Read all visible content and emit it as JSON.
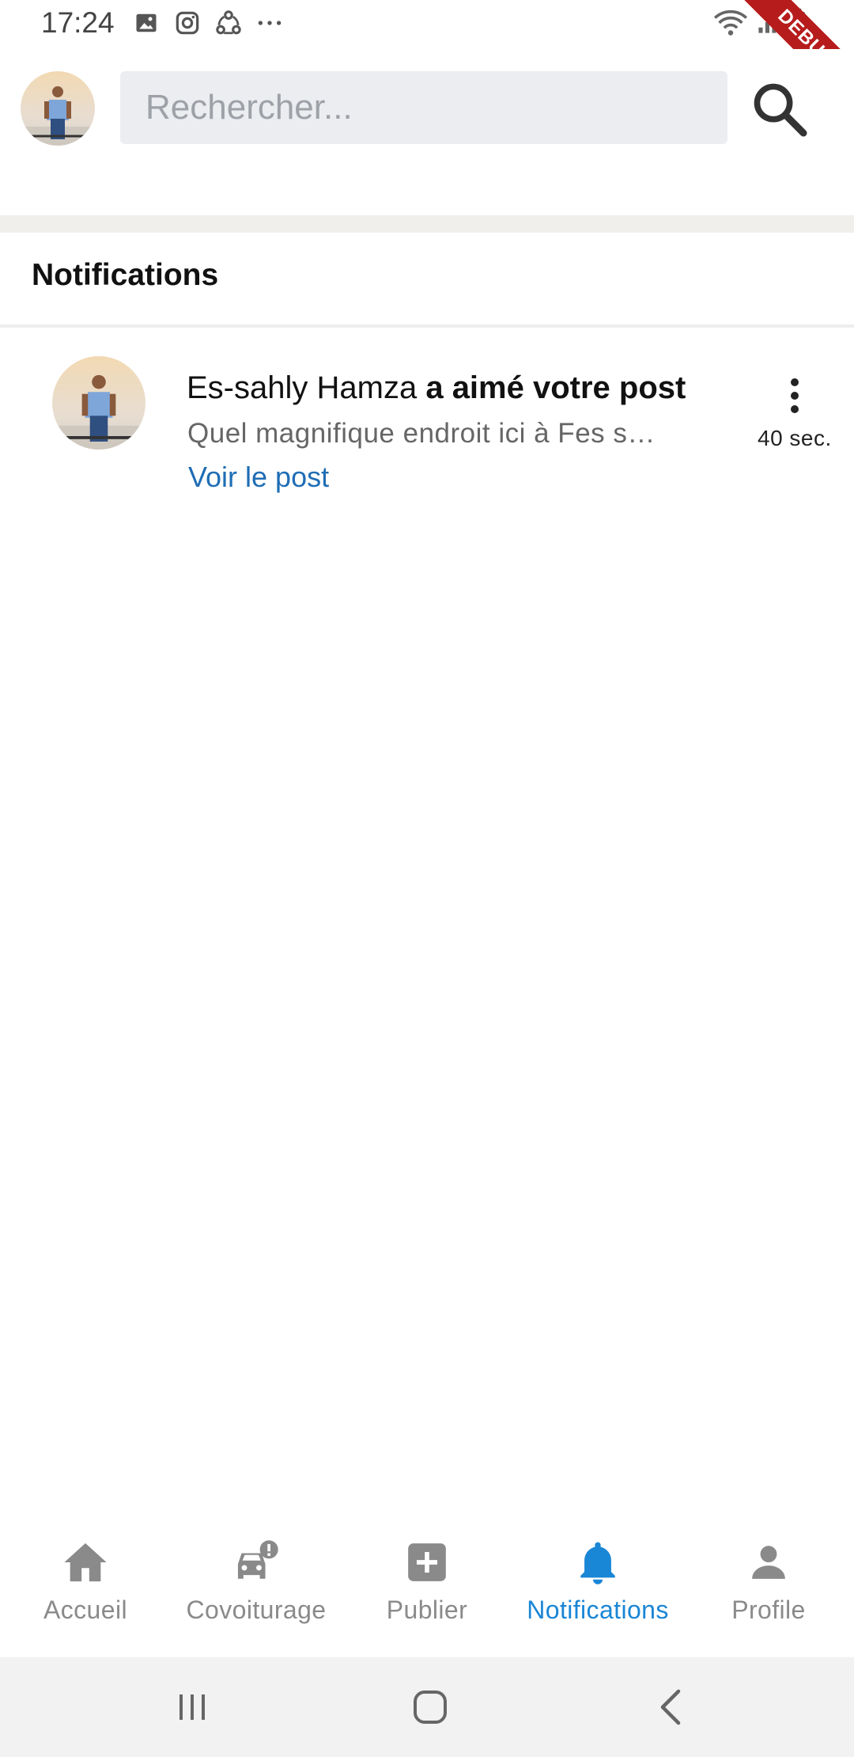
{
  "status_bar": {
    "time": "17:24",
    "left_icons": [
      "image-icon",
      "instagram-icon",
      "share-nodes-icon",
      "more-dots-icon"
    ],
    "right_icons": [
      "wifi-icon",
      "signal-icon",
      "battery-charging-icon"
    ],
    "debug_label": "DEBUG"
  },
  "header": {
    "search_placeholder": "Rechercher..."
  },
  "section": {
    "title": "Notifications"
  },
  "notifications": [
    {
      "user": "Es-sahly Hamza",
      "action": "a aimé votre post",
      "excerpt": "Quel magnifique endroit ici à Fes s…",
      "link": "Voir le post",
      "time": "40 sec."
    }
  ],
  "bottom_nav": {
    "active": "Notifications",
    "active_color": "#1a86d6",
    "inactive_color": "#8a8a8a",
    "items": [
      {
        "label": "Accueil",
        "icon": "home-icon"
      },
      {
        "label": "Covoiturage",
        "icon": "car-alert-icon"
      },
      {
        "label": "Publier",
        "icon": "add-box-icon"
      },
      {
        "label": "Notifications",
        "icon": "bell-icon"
      },
      {
        "label": "Profile",
        "icon": "person-icon"
      }
    ]
  },
  "system_nav": [
    "recents-icon",
    "home-circle-icon",
    "back-icon"
  ]
}
